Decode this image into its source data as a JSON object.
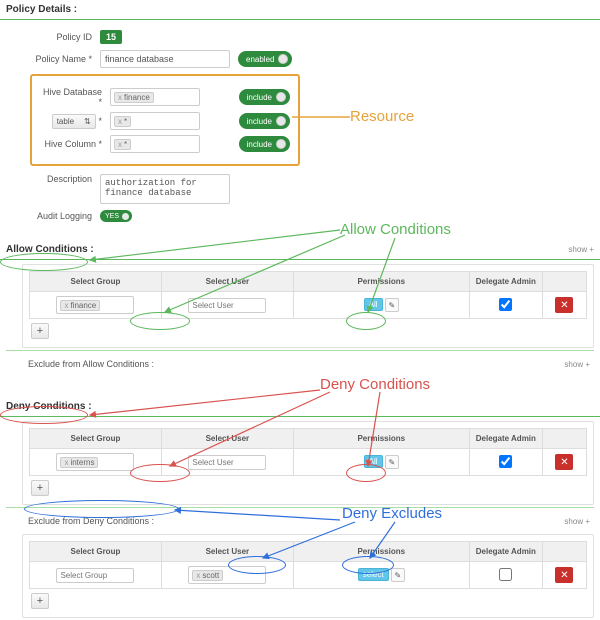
{
  "header": {
    "title": "Policy Details :"
  },
  "policy": {
    "id_label": "Policy ID",
    "id_value": "15",
    "name_label": "Policy Name *",
    "name_value": "finance database",
    "enabled_label": "enabled",
    "desc_label": "Description",
    "desc_value": "authorization for finance database",
    "audit_label": "Audit Logging",
    "audit_value": "YES"
  },
  "resource": {
    "db_label": "Hive Database *",
    "db_tag": "finance",
    "include": "include",
    "scope_select": "table",
    "scope_tag": "*",
    "col_label": "Hive Column *",
    "col_tag": "*"
  },
  "sections": {
    "allow": "Allow Conditions :",
    "exclude_allow": "Exclude from Allow Conditions :",
    "deny": "Deny Conditions :",
    "exclude_deny": "Exclude from Deny Conditions :",
    "show": "show  +"
  },
  "table": {
    "h_group": "Select Group",
    "h_user": "Select User",
    "h_perm": "Permissions",
    "h_delegate": "Delegate Admin",
    "ph_group": "Select Group",
    "ph_user": "Select User",
    "perm_all": "All",
    "perm_select": "select"
  },
  "rows": {
    "allow_group": "finance",
    "deny_group": "interns",
    "excl_user": "scott"
  },
  "icons": {
    "x": "x",
    "pencil": "✎",
    "trash": "✕",
    "plus": "+",
    "updown": "⇅",
    "check": "✓"
  },
  "annotations": {
    "resource": "Resource",
    "allow": "Allow Conditions",
    "deny": "Deny Conditions",
    "excludes": "Deny Excludes"
  }
}
